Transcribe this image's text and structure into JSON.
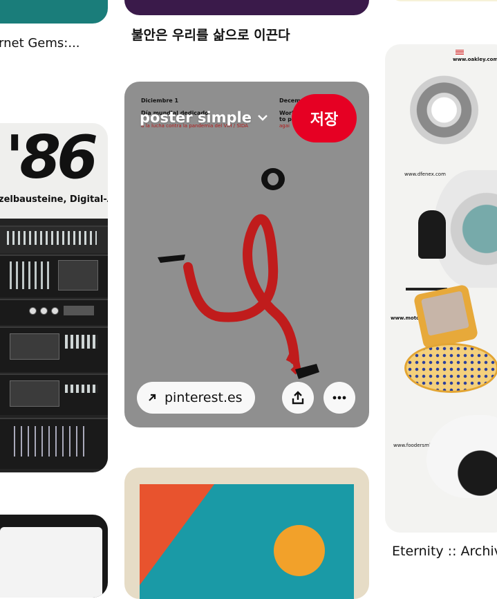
{
  "column_left": {
    "top_caption": "rnet Gems:...",
    "stereo_pin": {
      "headline": "'86",
      "subline": "zelbausteine, Digital-Audio,"
    }
  },
  "column_center": {
    "top_caption": "불안은 우리를 삶으로 이끈다",
    "poster_pin": {
      "board_name": "poster simple",
      "save_label": "저장",
      "link_label": "pinterest.es",
      "date_left": "Diciembre 1",
      "date_right": "Decem",
      "line1": "Día mundial dedicado",
      "line2": "a la lucha contra la pandemia del VIH / SIDA",
      "line_right1": "Worl",
      "line_right2": "to p",
      "line_right3": "agai"
    }
  },
  "column_right": {
    "ads_pin": {
      "site1": "www.oakley.com",
      "site2": "www.dfenex.com",
      "site3": "www.motorola.com",
      "site4": "www.foodersmith.com"
    },
    "bottom_caption": "Eternity :: Archiv"
  },
  "colors": {
    "save_red": "#e60023",
    "poster_gray": "#8f8f8f",
    "ribbon_red": "#c01c1c",
    "teal": "#1a9aa6",
    "orange": "#e8532e",
    "sun": "#f2a12a"
  }
}
